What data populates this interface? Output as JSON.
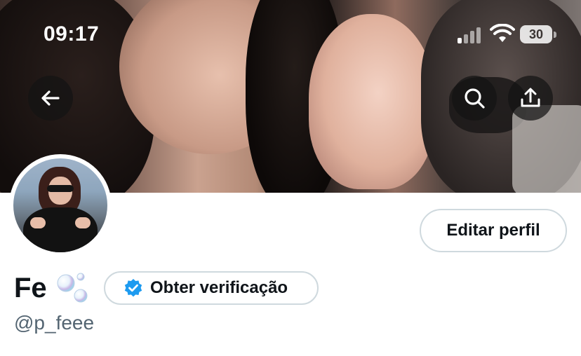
{
  "status_bar": {
    "time": "09:17",
    "battery": "30",
    "signal_bars_active": 1,
    "icons": [
      "cellular-signal-icon",
      "wifi-icon",
      "battery-icon"
    ]
  },
  "header": {
    "back_icon": "arrow-left-icon",
    "search_icon": "search-icon",
    "share_icon": "share-upload-icon"
  },
  "profile": {
    "display_name": "Fe",
    "name_emoji": "bubbles-emoji",
    "handle": "@p_feee",
    "edit_button_label": "Editar perfil",
    "verification_button_label": "Obter verificação",
    "verification_icon": "verified-badge-icon"
  },
  "colors": {
    "text_primary": "#0f1419",
    "text_secondary": "#536471",
    "border": "#cfd9de",
    "verified_blue": "#1d9bf0",
    "overlay_button": "#141414"
  }
}
